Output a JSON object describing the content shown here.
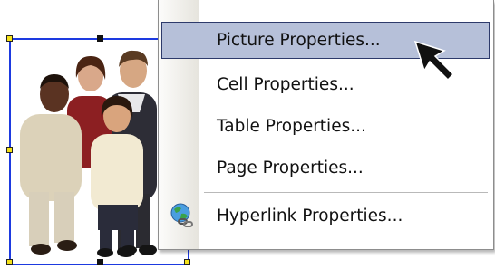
{
  "context_menu": {
    "items": [
      {
        "label": "Picture Properties...",
        "selected": true
      },
      {
        "label": "Cell Properties...",
        "selected": false
      },
      {
        "label": "Table Properties...",
        "selected": false
      },
      {
        "label": "Page Properties...",
        "selected": false
      },
      {
        "label": "Hyperlink Properties...",
        "selected": false,
        "icon": "globe-link-icon"
      }
    ]
  },
  "image": {
    "subject": "group of people",
    "selection_color": "#1d3ae0",
    "handle_color": "#f5e21a"
  },
  "colors": {
    "menu_highlight": "#b6c0d9",
    "menu_highlight_border": "#2d3a6b"
  }
}
